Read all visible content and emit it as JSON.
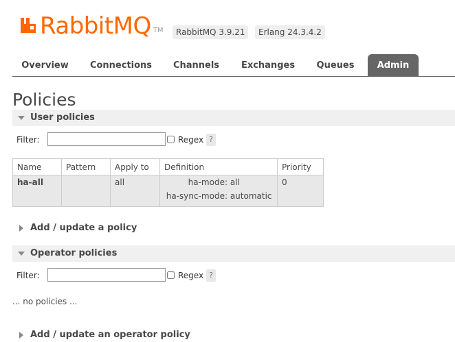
{
  "header": {
    "logo_text": "RabbitMQ",
    "logo_tm": "TM",
    "rabbitmq_version": "RabbitMQ 3.9.21",
    "erlang_version": "Erlang 24.3.4.2"
  },
  "tabs": [
    {
      "label": "Overview",
      "active": false
    },
    {
      "label": "Connections",
      "active": false
    },
    {
      "label": "Channels",
      "active": false
    },
    {
      "label": "Exchanges",
      "active": false
    },
    {
      "label": "Queues",
      "active": false
    },
    {
      "label": "Admin",
      "active": true
    }
  ],
  "page": {
    "title": "Policies"
  },
  "user_policies": {
    "heading": "User policies",
    "filter_label": "Filter:",
    "filter_value": "",
    "regex_label": "Regex",
    "help_label": "?",
    "columns": [
      "Name",
      "Pattern",
      "Apply to",
      "Definition",
      "Priority"
    ],
    "rows": [
      {
        "name": "ha-all",
        "pattern": "",
        "apply_to": "all",
        "definition": [
          {
            "key": "ha-mode:",
            "value": "all"
          },
          {
            "key": "ha-sync-mode:",
            "value": "automatic"
          }
        ],
        "priority": "0"
      }
    ],
    "add_update_label": "Add / update a policy"
  },
  "operator_policies": {
    "heading": "Operator policies",
    "filter_label": "Filter:",
    "filter_value": "",
    "regex_label": "Regex",
    "help_label": "?",
    "empty_text": "... no policies ...",
    "add_update_label": "Add / update an operator policy"
  },
  "colors": {
    "brand_orange": "#ff6600",
    "active_tab_bg": "#666666",
    "section_bg": "#f0f0f0",
    "row_bg": "#e8e8e8"
  }
}
